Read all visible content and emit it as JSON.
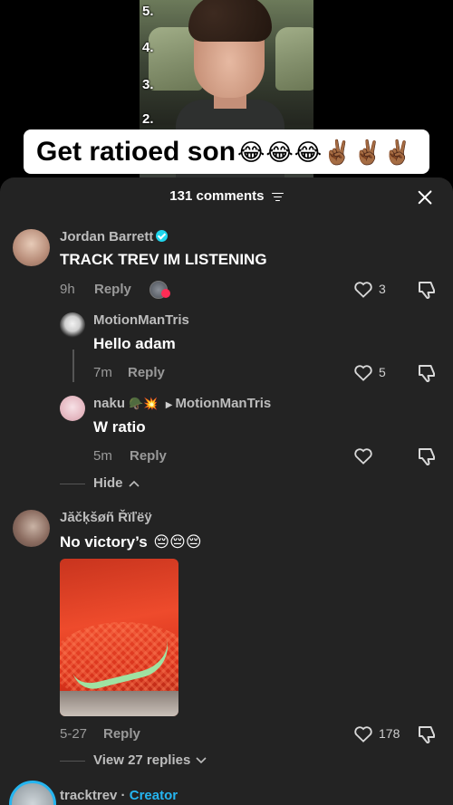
{
  "video": {
    "countdown": [
      "5.",
      "4.",
      "3.",
      "2."
    ],
    "caption": "Get ratioed son",
    "caption_emojis": "😂😂😂✌🏾✌🏾✌🏾"
  },
  "header": {
    "title": "131 comments"
  },
  "comments": [
    {
      "username": "Jordan Barrett",
      "verified": true,
      "text": "TRACK TREV IM LISTENING",
      "time": "9h",
      "reply_label": "Reply",
      "likes": "3",
      "replies": [
        {
          "username": "MotionManTris",
          "text": "Hello adam",
          "time": "7m",
          "reply_label": "Reply",
          "likes": "5"
        },
        {
          "username": "naku",
          "user_emojis": "🪖💥",
          "replying_to": "MotionManTris",
          "text": "W ratio",
          "time": "5m",
          "reply_label": "Reply",
          "likes": ""
        }
      ],
      "hide_label": "Hide"
    },
    {
      "username": "Jăčķšøñ Řïľëÿ",
      "text": "No victory’s",
      "text_emojis": "😔😔😔",
      "time": "5-27",
      "reply_label": "Reply",
      "likes": "178",
      "view_replies_label": "View 27 replies"
    }
  ],
  "next_comment": {
    "username": "tracktrev",
    "separator": " · ",
    "tag": "Creator"
  },
  "colors": {
    "panel_bg": "#232323",
    "verified_badge": "#20d5ec",
    "creator_tag": "#25b5f0"
  }
}
